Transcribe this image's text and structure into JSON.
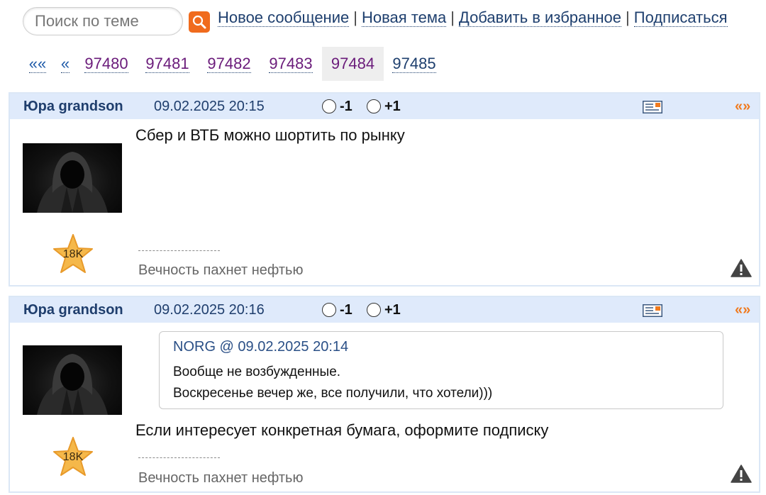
{
  "search": {
    "placeholder": "Поиск по теме"
  },
  "toolbar": {
    "links": [
      "Новое сообщение",
      "Новая тема",
      "Добавить в избранное",
      "Подписаться"
    ],
    "separator": "|"
  },
  "pager": {
    "first": "««",
    "prev": "«",
    "pages": [
      "97480",
      "97481",
      "97482",
      "97483",
      "97484",
      "97485"
    ],
    "current": "97484"
  },
  "colors": {
    "accent": "#f06b1d",
    "header_bg": "#dfeafb",
    "link": "#1e3f6e",
    "visited": "#6a1b7a"
  },
  "posts": [
    {
      "author": "Юра grandson",
      "date": "09.02.2025 20:15",
      "vote_minus": "-1",
      "vote_plus": "+1",
      "quote_symbol": "«»",
      "rating": "18K",
      "text": "Сбер и ВТБ можно шортить по рынку",
      "signature": "Вечность пахнет нефтью"
    },
    {
      "author": "Юра grandson",
      "date": "09.02.2025 20:16",
      "vote_minus": "-1",
      "vote_plus": "+1",
      "quote_symbol": "«»",
      "rating": "18K",
      "quote": {
        "header": "NORG @ 09.02.2025 20:14",
        "line1": "Вообще не возбужденные.",
        "line2": "Воскресенье вечер же, все получили, что хотели)))"
      },
      "text": "Если интересует конкретная бумага, оформите подписку",
      "signature": "Вечность пахнет нефтью"
    }
  ]
}
